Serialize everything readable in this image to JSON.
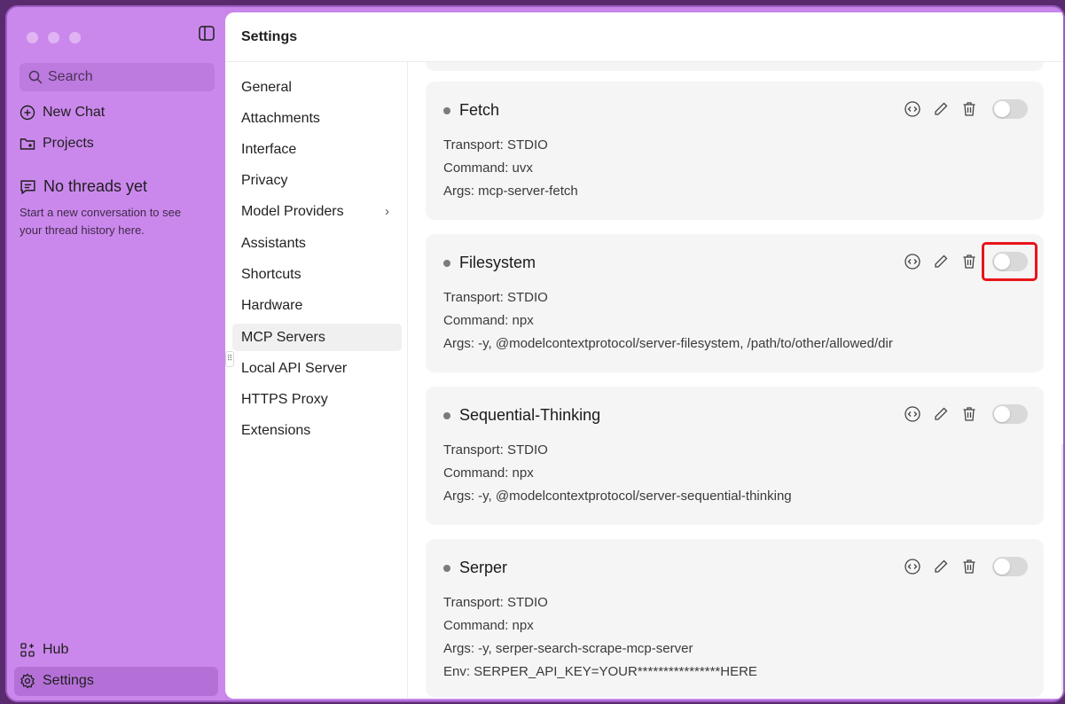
{
  "sidebar": {
    "search_placeholder": "Search",
    "new_chat": "New Chat",
    "projects": "Projects",
    "no_threads_title": "No threads yet",
    "no_threads_sub": "Start a new conversation to see your thread history here.",
    "hub": "Hub",
    "settings": "Settings"
  },
  "header": {
    "title": "Settings"
  },
  "settings_nav": [
    {
      "label": "General"
    },
    {
      "label": "Attachments"
    },
    {
      "label": "Interface"
    },
    {
      "label": "Privacy"
    },
    {
      "label": "Model Providers"
    },
    {
      "label": "Assistants"
    },
    {
      "label": "Shortcuts"
    },
    {
      "label": "Hardware"
    },
    {
      "label": "MCP Servers"
    },
    {
      "label": "Local API Server"
    },
    {
      "label": "HTTPS Proxy"
    },
    {
      "label": "Extensions"
    }
  ],
  "servers": [
    {
      "name": "Fetch",
      "transport": "Transport: STDIO",
      "command": "Command: uvx",
      "args": "Args: mcp-server-fetch",
      "enabled": false
    },
    {
      "name": "Filesystem",
      "transport": "Transport: STDIO",
      "command": "Command: npx",
      "args": "Args: -y, @modelcontextprotocol/server-filesystem, /path/to/other/allowed/dir",
      "enabled": false
    },
    {
      "name": "Sequential-Thinking",
      "transport": "Transport: STDIO",
      "command": "Command: npx",
      "args": "Args: -y, @modelcontextprotocol/server-sequential-thinking",
      "enabled": false
    },
    {
      "name": "Serper",
      "transport": "Transport: STDIO",
      "command": "Command: npx",
      "args": "Args: -y, serper-search-scrape-mcp-server",
      "env": "Env: SERPER_API_KEY=YOUR****************HERE",
      "enabled": false
    }
  ],
  "colors": {
    "sidebar": "#cb88ec",
    "highlight": "#e8141b"
  }
}
